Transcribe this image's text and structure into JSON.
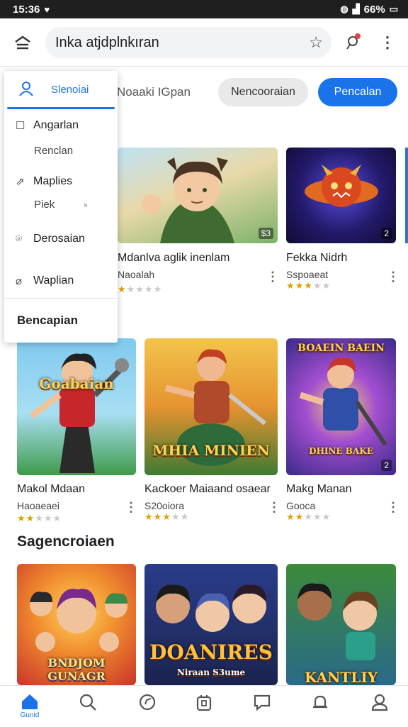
{
  "status_bar": {
    "time": "15:36",
    "battery": "66%",
    "icons": [
      "heart-icon",
      "data-saver-icon",
      "signal-icon",
      "battery-icon"
    ]
  },
  "search": {
    "value": "Inka atjdplnkıran"
  },
  "drawer": {
    "account_name": "Slenoiai",
    "items": [
      {
        "label": "Angarlan",
        "icon": "square-icon"
      },
      {
        "label": "Renclan",
        "icon": ""
      },
      {
        "label": "Maplies",
        "icon": "share-icon"
      },
      {
        "label": "Piek",
        "icon": ""
      },
      {
        "label": "Derosaian",
        "icon": "leaf-icon"
      },
      {
        "label": "Waplian",
        "icon": "tag-icon"
      }
    ],
    "footer": "Bencapian"
  },
  "tabs": {
    "text_tab": "Noaaki IGpan",
    "chip_grey": "Nencooraian",
    "chip_blue": "Pencalan"
  },
  "row1": [
    {
      "title": "Mdanlva aglik inenlam",
      "subtitle": "Naoalah",
      "stars": 1,
      "badge": "$3",
      "accent": "#6fa86a"
    },
    {
      "title": "Fekka Nidrh",
      "subtitle": "Sspoaeat",
      "stars": 3,
      "badge": "2",
      "accent": "#1b2a7a"
    }
  ],
  "row2": [
    {
      "title": "Makol Mdaan",
      "subtitle": "Haoaeaei",
      "stars": 2,
      "art_title": "Goabaian",
      "badge": "",
      "accent": "#3aa0d8"
    },
    {
      "title": "Kackoer Maiaand osaear",
      "subtitle": "S20oiora",
      "stars": 3,
      "art_title": "MHIA MINIEN",
      "badge": "",
      "accent": "#c77a1f"
    },
    {
      "title": "Makg Manan",
      "subtitle": "Gooca",
      "stars": 2,
      "art_title": "BOAEIN BAEIN",
      "art_sub": "DHINE BAKE",
      "badge": "2",
      "accent": "#6a3fb8"
    }
  ],
  "section": {
    "title": "Sagencroiaen"
  },
  "row3": [
    {
      "art_title": "BNDJOM GUNAGR",
      "accent": "#e7582a"
    },
    {
      "art_title": "DOANIRES",
      "art_sub": "Niraan S3ume",
      "accent": "#2a3d8a"
    },
    {
      "art_title": "KANTLIY",
      "accent": "#3c8a3a"
    }
  ],
  "bottom_nav": {
    "home_label": "Gunid"
  }
}
